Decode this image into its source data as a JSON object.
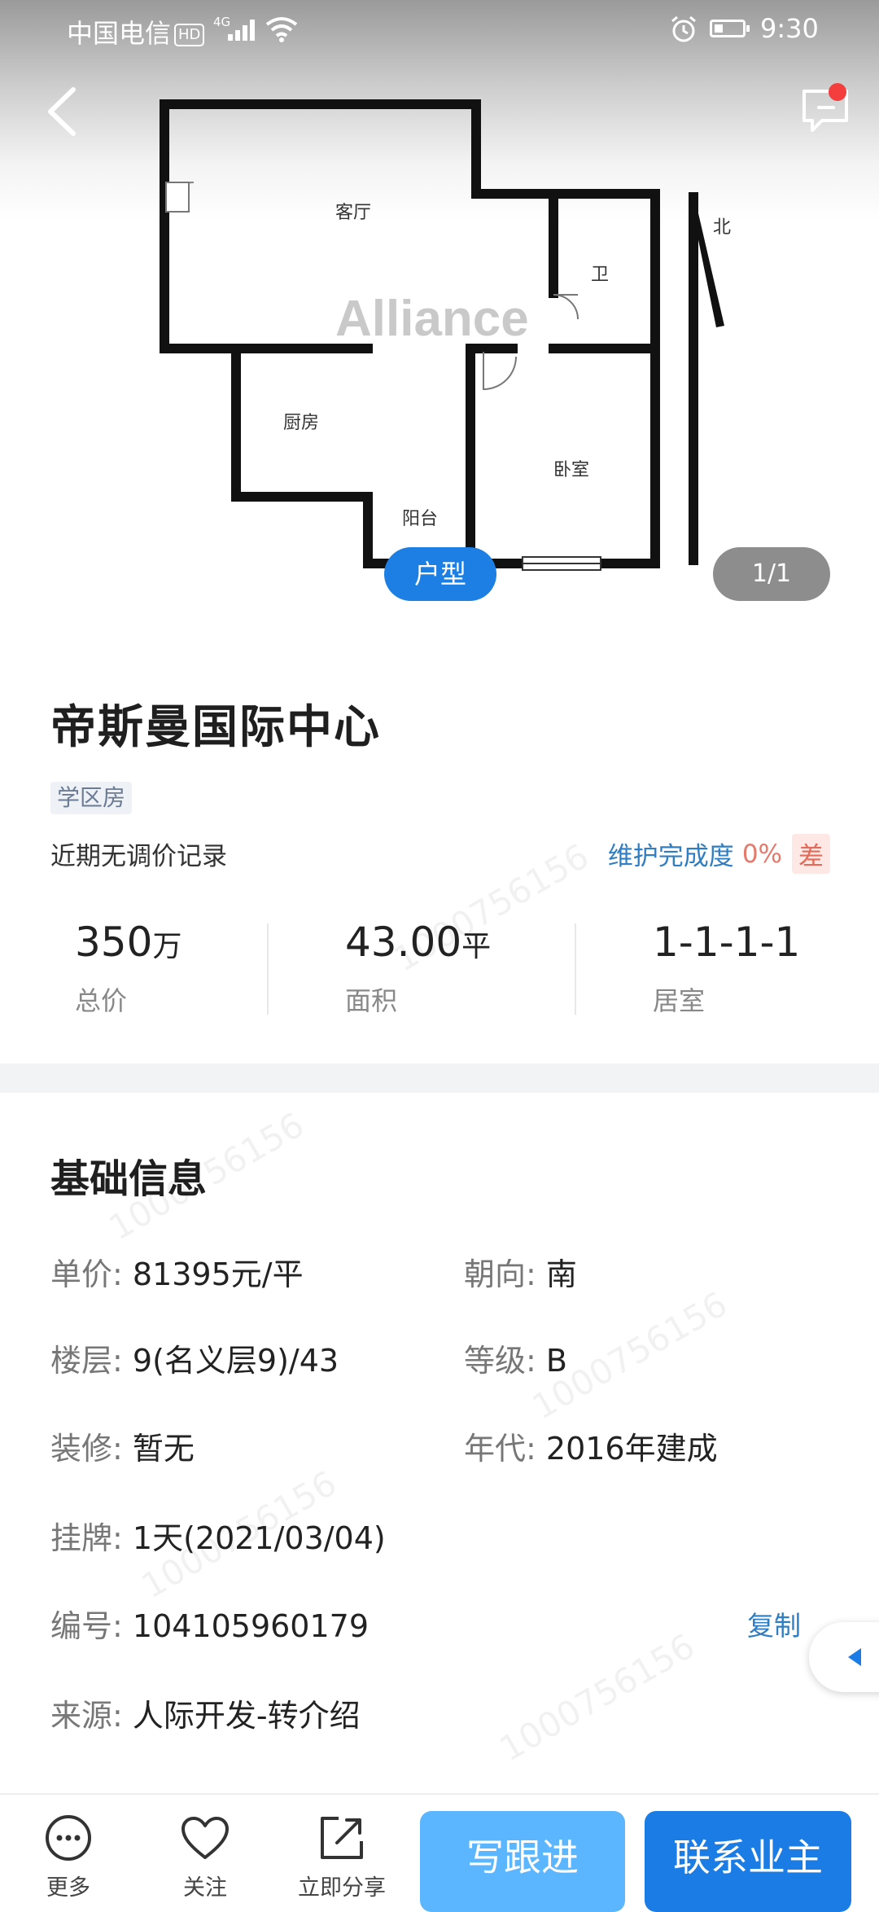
{
  "status_bar": {
    "carrier": "中国电信",
    "hd": "HD",
    "network": "4G",
    "time": "9:30"
  },
  "header": {
    "back_icon": "chevron-left-icon",
    "message_icon": "chat-icon"
  },
  "floor_plan": {
    "logo_text": "Alliance",
    "rooms": {
      "living_room": "客厅",
      "bathroom": "卫",
      "kitchen": "厨房",
      "bedroom": "卧室",
      "balcony": "阳台",
      "north": "北"
    },
    "type_button": "户型",
    "pager": "1/1"
  },
  "listing": {
    "title": "帝斯曼国际中心",
    "tag": "学区房",
    "price_note": "近期无调价记录",
    "maintenance": {
      "label": "维护完成度",
      "percent": "0%",
      "grade": "差"
    },
    "stats": [
      {
        "value": "350",
        "unit": "万",
        "label": "总价"
      },
      {
        "value": "43.00",
        "unit": "平",
        "label": "面积"
      },
      {
        "value": "1-1-1-1",
        "unit": "",
        "label": "居室"
      }
    ]
  },
  "basic_info": {
    "heading": "基础信息",
    "unit_price": {
      "key": "单价: ",
      "value": "81395元/平"
    },
    "orientation": {
      "key": "朝向: ",
      "value": "南"
    },
    "floor": {
      "key": "楼层: ",
      "value": "9(名义层9)/43"
    },
    "grade": {
      "key": "等级: ",
      "value": "B"
    },
    "decoration": {
      "key": "装修: ",
      "value": "暂无"
    },
    "year": {
      "key": "年代: ",
      "value": "2016年建成"
    },
    "listed": {
      "key": "挂牌: ",
      "value": "1天(2021/03/04)"
    },
    "number": {
      "key": "编号: ",
      "value": "104105960179"
    },
    "copy_label": "复制",
    "source": {
      "key": "来源: ",
      "value": "人际开发-转介绍"
    }
  },
  "bottom_bar": {
    "more": "更多",
    "follow": "关注",
    "share": "立即分享",
    "write_followup": "写跟进",
    "contact_owner": "联系业主"
  },
  "watermark": "1000756156",
  "colors": {
    "primary": "#1a7ce4",
    "light_primary": "#5bb6ff",
    "link": "#2f7dc2",
    "warn": "#e36b5a"
  }
}
